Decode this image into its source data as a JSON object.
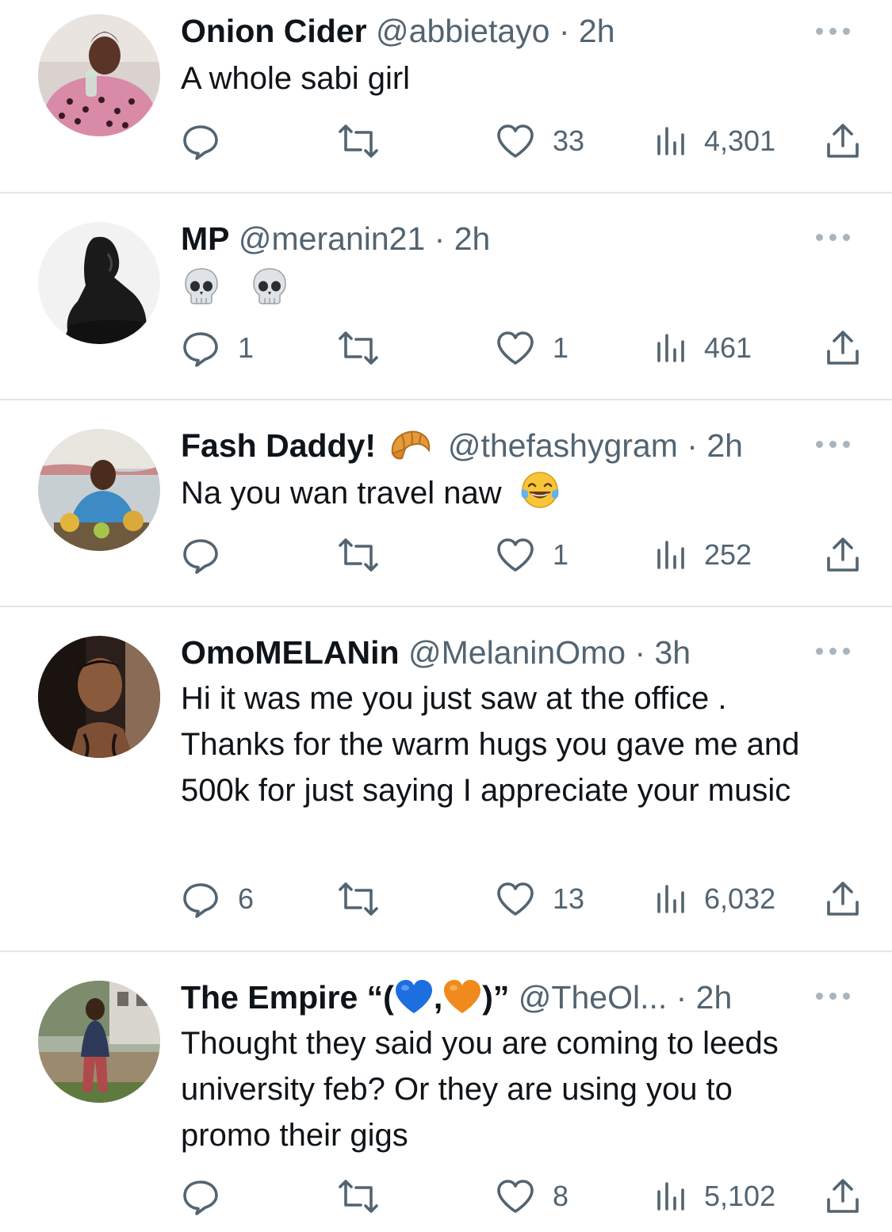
{
  "colors": {
    "text": "#0f1419",
    "secondary": "#536471",
    "divider": "#e1e4e8",
    "heart_emoji_blue": "#1d6fe0",
    "heart_emoji_orange": "#f08a1c"
  },
  "tweets": [
    {
      "name": "Onion Cider",
      "handle": "@abbietayo · 2h",
      "text": "A whole sabi girl",
      "replies": "",
      "retweets": "",
      "likes": "33",
      "views": "4,301"
    },
    {
      "name": "MP",
      "handle": "@meranin21 · 2h",
      "text": "",
      "emojis": [
        "skull",
        "skull"
      ],
      "replies": "1",
      "retweets": "",
      "likes": "1",
      "views": "461"
    },
    {
      "name": "Fash Daddy!",
      "name_emoji": "croissant",
      "handle": "@thefashygram · 2h",
      "text": "Na you wan travel naw",
      "text_emoji": "tears-of-joy",
      "replies": "",
      "retweets": "",
      "likes": "1",
      "views": "252"
    },
    {
      "name": "OmoMELANin",
      "handle": "@MelaninOmo · 3h",
      "text": "Hi it was me you just saw at the office  . Thanks for the warm hugs you gave me and 500k for just saying I appreciate your music",
      "replies": "6",
      "retweets": "",
      "likes": "13",
      "views": "6,032"
    },
    {
      "name_prefix": "The Empire “(",
      "name_sep": ",",
      "name_suffix": ")”",
      "handle": "@TheOl... · 2h",
      "text": "Thought they said you are coming to leeds university feb? Or they are using you to promo their gigs",
      "replies": "",
      "retweets": "",
      "likes": "8",
      "views": "5,102"
    }
  ]
}
